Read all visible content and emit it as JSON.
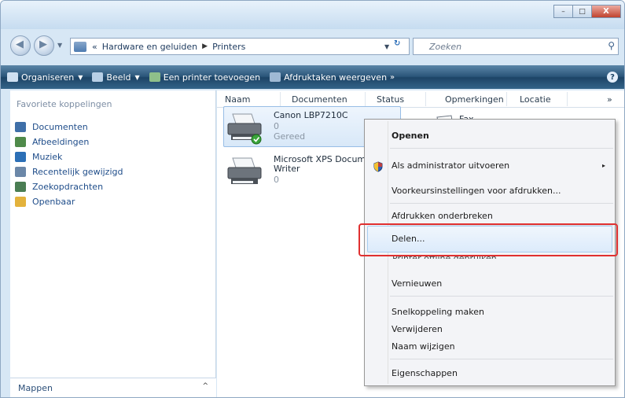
{
  "window": {
    "address": {
      "crumbs": [
        "Hardware en geluiden",
        "Printers"
      ],
      "prefix": "«"
    },
    "search_placeholder": "Zoeken",
    "buttons": {
      "minimize": "–",
      "maximize": "□",
      "close": "X"
    }
  },
  "toolbar": {
    "organize": "Organiseren",
    "view": "Beeld",
    "add_printer": "Een printer toevoegen",
    "print_jobs": "Afdruktaken weergeven",
    "more": "»",
    "help": "?"
  },
  "navpane": {
    "heading": "Favoriete koppelingen",
    "items": [
      {
        "label": "Documenten",
        "icon": "documents-icon",
        "color": "#3f6fa8"
      },
      {
        "label": "Afbeeldingen",
        "icon": "pictures-icon",
        "color": "#4f8a4a"
      },
      {
        "label": "Muziek",
        "icon": "music-icon",
        "color": "#2c6fb6"
      },
      {
        "label": "Recentelijk gewijzigd",
        "icon": "recent-icon",
        "color": "#6b87a8"
      },
      {
        "label": "Zoekopdrachten",
        "icon": "searches-icon",
        "color": "#4a7d53"
      },
      {
        "label": "Openbaar",
        "icon": "public-icon",
        "color": "#e3b23c"
      }
    ],
    "folders_label": "Mappen",
    "folders_chevron": "^"
  },
  "columns": [
    "Naam",
    "Documenten",
    "Status",
    "Opmerkingen",
    "Locatie",
    "»"
  ],
  "printers": [
    {
      "name": "Canon LBP7210C",
      "docs": "0",
      "status": "Gereed"
    },
    {
      "name": "Microsoft XPS Docum",
      "name2": "Writer",
      "docs": "0"
    }
  ],
  "fax": {
    "name": "Fax"
  },
  "context_menu": {
    "open": "Openen",
    "run_as_admin": "Als administrator uitvoeren",
    "sub_arrow": "▸",
    "print_prefs": "Voorkeursinstellingen voor afdrukken...",
    "pause": "Afdrukken onderbreken",
    "share": "Delen...",
    "offline": "Printer offline gebruiken",
    "refresh": "Vernieuwen",
    "shortcut": "Snelkoppeling maken",
    "delete": "Verwijderen",
    "rename": "Naam wijzigen",
    "properties": "Eigenschappen"
  },
  "colors": {
    "toolbar": "#2a5579",
    "highlight": "#e03030",
    "link": "#1f4d8a"
  }
}
